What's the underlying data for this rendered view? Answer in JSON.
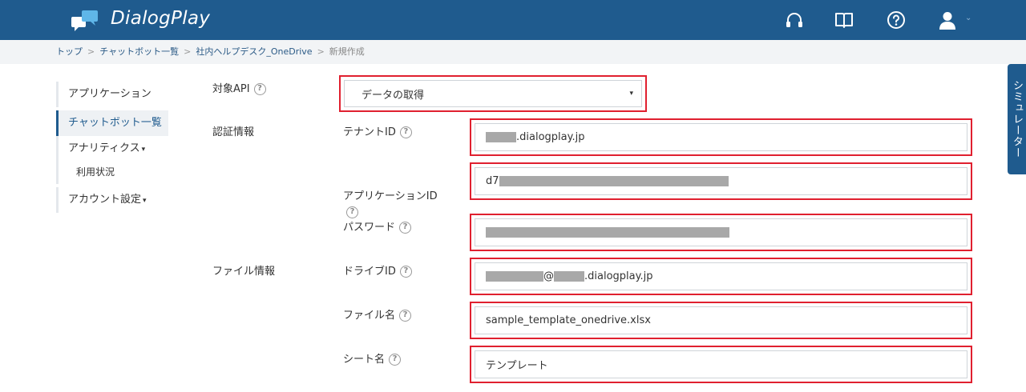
{
  "header": {
    "brand": "DialogPlay",
    "icons": [
      "headset-icon",
      "book-icon",
      "help-circle-icon",
      "user-icon"
    ],
    "user_caret": "⌄"
  },
  "breadcrumb": {
    "items": [
      "トップ",
      "チャットボット一覧",
      "社内ヘルプデスク_OneDrive"
    ],
    "current": "新規作成",
    "separator": ">"
  },
  "sidebar": {
    "items": [
      {
        "label": "アプリケーション"
      },
      {
        "label": "チャットボット一覧"
      },
      {
        "label": "アナリティクス"
      },
      {
        "label": "利用状況"
      },
      {
        "label": "アカウント設定"
      }
    ],
    "caret": "▾"
  },
  "simulator": {
    "label": "シミュレーター"
  },
  "form": {
    "help_glyph": "?",
    "api": {
      "label": "対象API",
      "value": "データの取得",
      "arrow": "▾"
    },
    "auth_section": "認証情報",
    "file_section": "ファイル情報",
    "tenant": {
      "label": "テナントID",
      "value_suffix": ".dialogplay.jp"
    },
    "app_id": {
      "label": "アプリケーションID",
      "value_prefix": "d7"
    },
    "password": {
      "label": "パスワード"
    },
    "drive": {
      "label": "ドライブID",
      "at": "@",
      "value_suffix": ".dialogplay.jp"
    },
    "filename": {
      "label": "ファイル名",
      "value": "sample_template_onedrive.xlsx"
    },
    "sheet": {
      "label": "シート名",
      "value": "テンプレート"
    }
  },
  "colors": {
    "header_bg": "#1f5b8e",
    "highlight_border": "#e0202f",
    "mask": "#a8a8a8"
  }
}
